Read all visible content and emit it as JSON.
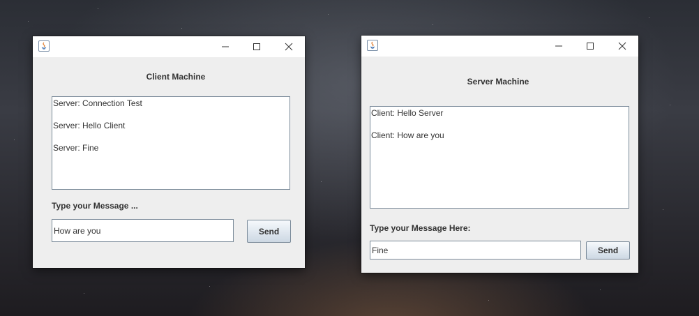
{
  "client_window": {
    "heading": "Client Machine",
    "messages": [
      "Server: Connection Test",
      "Server: Hello Client",
      "Server: Fine"
    ],
    "input_label": "Type your Message ...",
    "input_value": "How are you",
    "send_label": "Send",
    "controls": {
      "minimize_icon": "minimize-icon",
      "maximize_icon": "maximize-icon",
      "close_icon": "close-icon"
    }
  },
  "server_window": {
    "heading": "Server Machine",
    "messages": [
      "Client: Hello Server",
      "Client: How are you"
    ],
    "input_label": "Type your Message Here:",
    "input_value": "Fine",
    "send_label": "Send",
    "controls": {
      "minimize_icon": "minimize-icon",
      "maximize_icon": "maximize-icon",
      "close_icon": "close-icon"
    }
  }
}
